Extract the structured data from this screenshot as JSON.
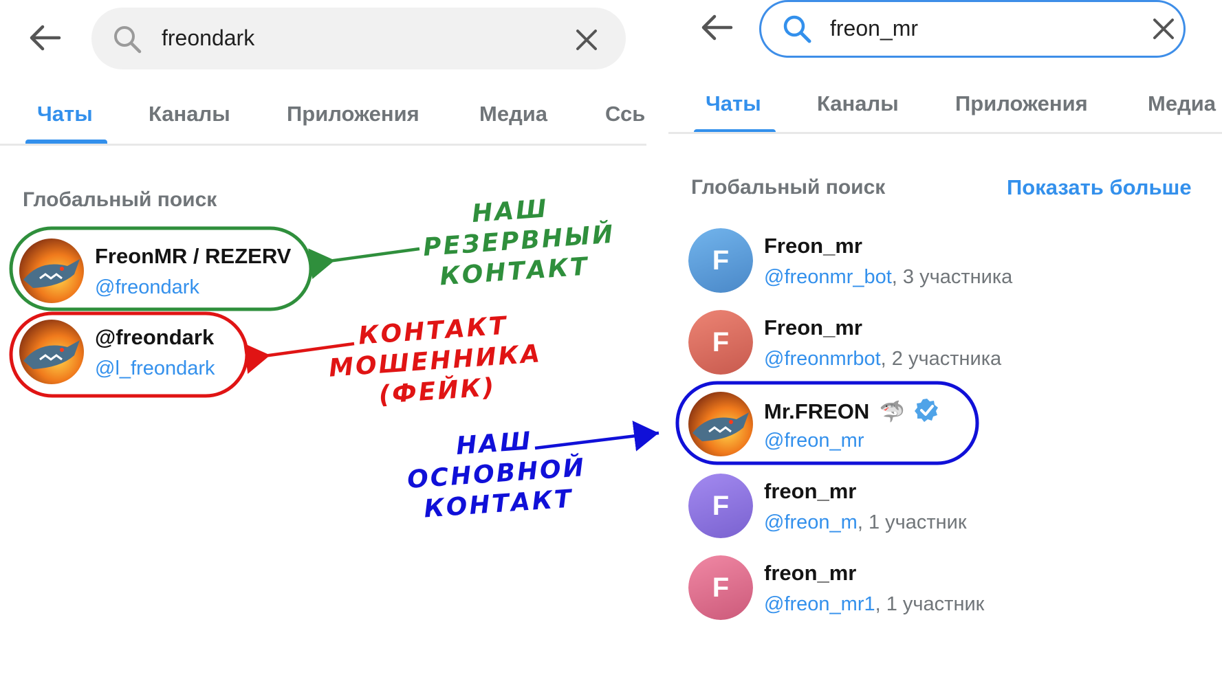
{
  "left": {
    "search": {
      "value": "freondark"
    },
    "tabs": [
      {
        "label": "Чаты",
        "active": true
      },
      {
        "label": "Каналы",
        "active": false
      },
      {
        "label": "Приложения",
        "active": false
      },
      {
        "label": "Медиа",
        "active": false
      },
      {
        "label": "Ссь",
        "active": false
      }
    ],
    "section_title": "Глобальный поиск",
    "results": [
      {
        "name": "FreonMR / REZERV",
        "handle": "@freondark",
        "avatar": "shark-avatar"
      },
      {
        "name": "@freondark",
        "handle": "@l_freondark",
        "avatar": "shark-avatar"
      }
    ]
  },
  "right": {
    "search": {
      "value": "freon_mr"
    },
    "tabs": [
      {
        "label": "Чаты",
        "active": true
      },
      {
        "label": "Каналы",
        "active": false
      },
      {
        "label": "Приложения",
        "active": false
      },
      {
        "label": "Медиа",
        "active": false
      }
    ],
    "section_title": "Глобальный поиск",
    "show_more": "Показать больше",
    "results": [
      {
        "name": "Freon_mr",
        "handle": "@freonmr_bot",
        "suffix": ", 3 участника",
        "avatar_letter": "F",
        "avatar_color": "#5a9bd8"
      },
      {
        "name": "Freon_mr",
        "handle": "@freonmrbot",
        "suffix": ", 2 участника",
        "avatar_letter": "F",
        "avatar_color": "#dc6b5e"
      },
      {
        "name": "Mr.FREON",
        "handle": "@freon_mr",
        "suffix": "",
        "avatar": "shark-avatar",
        "emoji": "🦈",
        "verified": true
      },
      {
        "name": "freon_mr",
        "handle": "@freon_m",
        "suffix": ", 1 участник",
        "avatar_letter": "F",
        "avatar_color": "#8b73e0"
      },
      {
        "name": "freon_mr",
        "handle": "@freon_mr1",
        "suffix": ", 1 участник",
        "avatar_letter": "F",
        "avatar_color": "#e06b8b"
      }
    ]
  },
  "annotations": {
    "reserve": {
      "lines": [
        "НАШ",
        "РЕЗЕРВНЫЙ",
        "КОНТАКТ"
      ],
      "color": "#2f8f3c"
    },
    "scam": {
      "lines": [
        "КОНТАКТ",
        "МОШЕННИКА",
        "(ФЕЙК)"
      ],
      "color": "#e01414"
    },
    "main": {
      "lines": [
        "НАШ",
        "ОСНОВНОЙ",
        "КОНТАКТ"
      ],
      "color": "#1010d8"
    }
  }
}
